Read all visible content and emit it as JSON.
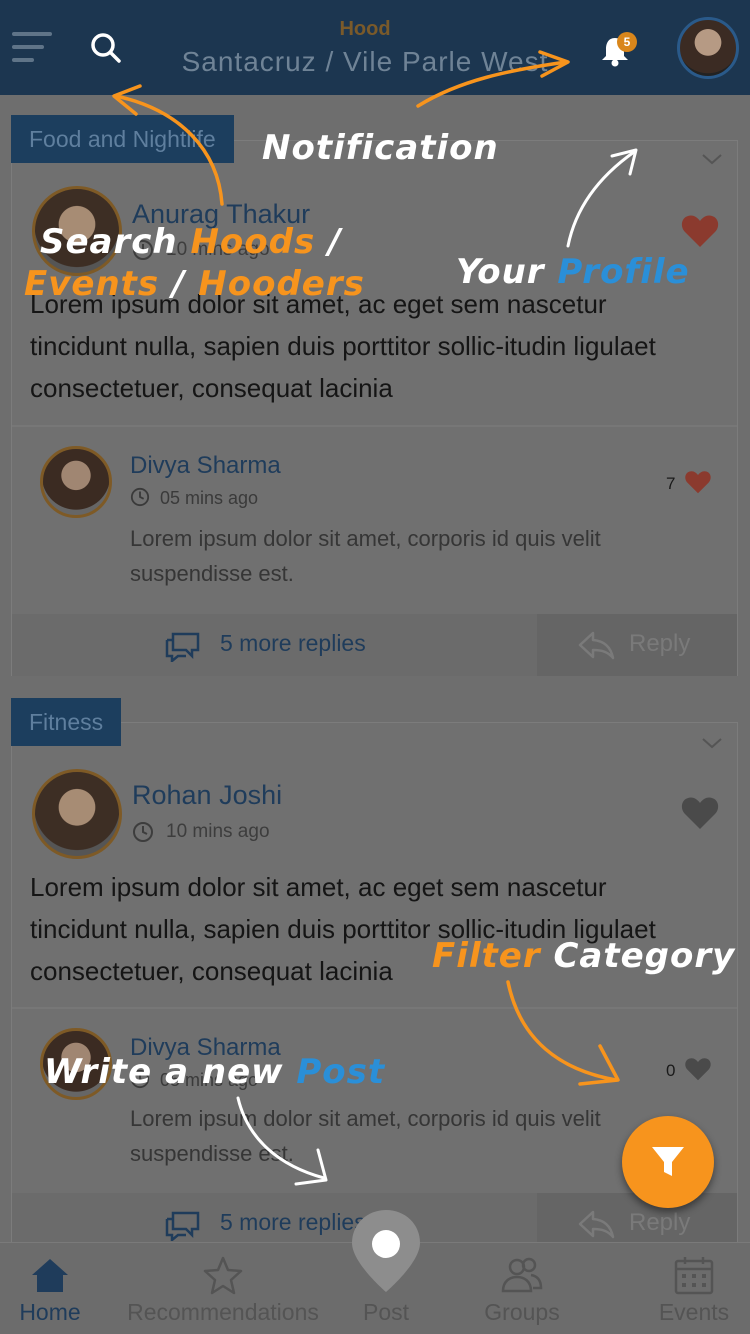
{
  "header": {
    "hood_label": "Hood",
    "hood_name": "Santacruz / Vile Parle West",
    "notification_count": "5"
  },
  "posts": [
    {
      "category": "Food and Nightlife",
      "author": "Anurag Thakur",
      "time": "10 mins ago",
      "body": "Lorem ipsum dolor sit amet, ac eget sem nascetur tincidunt nulla, sapien duis porttitor sollic-itudin ligulaet consectetuer, consequat lacinia",
      "liked": true,
      "reply": {
        "author": "Divya Sharma",
        "time": "05 mins ago",
        "body": "Lorem ipsum dolor sit amet, corporis id quis velit suspendisse est.",
        "likes": "7",
        "liked": true
      },
      "more_replies": "5 more replies",
      "reply_label": "Reply"
    },
    {
      "category": "Fitness",
      "author": "Rohan Joshi",
      "time": "10 mins ago",
      "body": "Lorem ipsum dolor sit amet, ac eget sem nascetur tincidunt nulla, sapien duis porttitor sollic-itudin ligulaet consectetuer, consequat lacinia",
      "liked": false,
      "reply": {
        "author": "Divya Sharma",
        "time": "05 mins ago",
        "body": "Lorem ipsum dolor sit amet, corporis id quis velit suspendisse est.",
        "likes": "0",
        "liked": false
      },
      "more_replies": "5 more replies",
      "reply_label": "Reply"
    }
  ],
  "annotations": {
    "notification": "Notification",
    "search": "Search",
    "hoods": "Hoods",
    "slash": "/",
    "events": "Events",
    "hooders": "Hooders",
    "your": "Your",
    "profile": "Profile",
    "filter": "Filter",
    "category": "Category",
    "write_a_new": "Write a new",
    "post": "Post"
  },
  "bottom_nav": {
    "home": "Home",
    "recommendations": "Recommendations",
    "post": "Post",
    "groups": "Groups",
    "events": "Events"
  },
  "colors": {
    "header_bg": "#1c3650",
    "accent_orange": "#f7941d",
    "accent_blue": "#2a8fd8",
    "heart_red": "#8b3a2e"
  }
}
